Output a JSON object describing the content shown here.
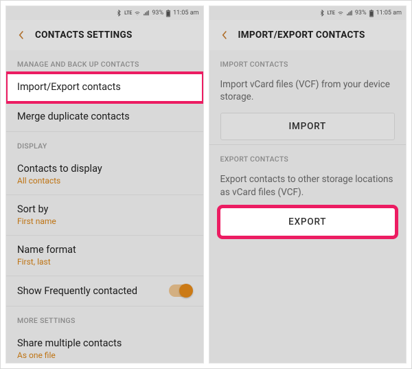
{
  "status": {
    "net_label": "LTE",
    "battery": "93%",
    "time": "11:05 am"
  },
  "left": {
    "title": "CONTACTS SETTINGS",
    "sections": {
      "manage": "MANAGE AND BACK UP CONTACTS",
      "display": "DISPLAY",
      "more": "MORE SETTINGS"
    },
    "rows": {
      "import_export": "Import/Export contacts",
      "merge": "Merge duplicate contacts",
      "contacts_display": "Contacts to display",
      "contacts_display_sub": "All contacts",
      "sort_by": "Sort by",
      "sort_by_sub": "First name",
      "name_format": "Name format",
      "name_format_sub": "First, last",
      "show_freq": "Show Frequently contacted",
      "share_multiple": "Share multiple contacts",
      "share_multiple_sub": "As one file"
    }
  },
  "right": {
    "title": "IMPORT/EXPORT CONTACTS",
    "sections": {
      "import": "IMPORT CONTACTS",
      "export": "EXPORT CONTACTS"
    },
    "import_desc": "Import vCard files (VCF) from your device storage.",
    "import_btn": "IMPORT",
    "export_desc": "Export contacts to other storage locations as vCard files (VCF).",
    "export_btn": "EXPORT"
  }
}
